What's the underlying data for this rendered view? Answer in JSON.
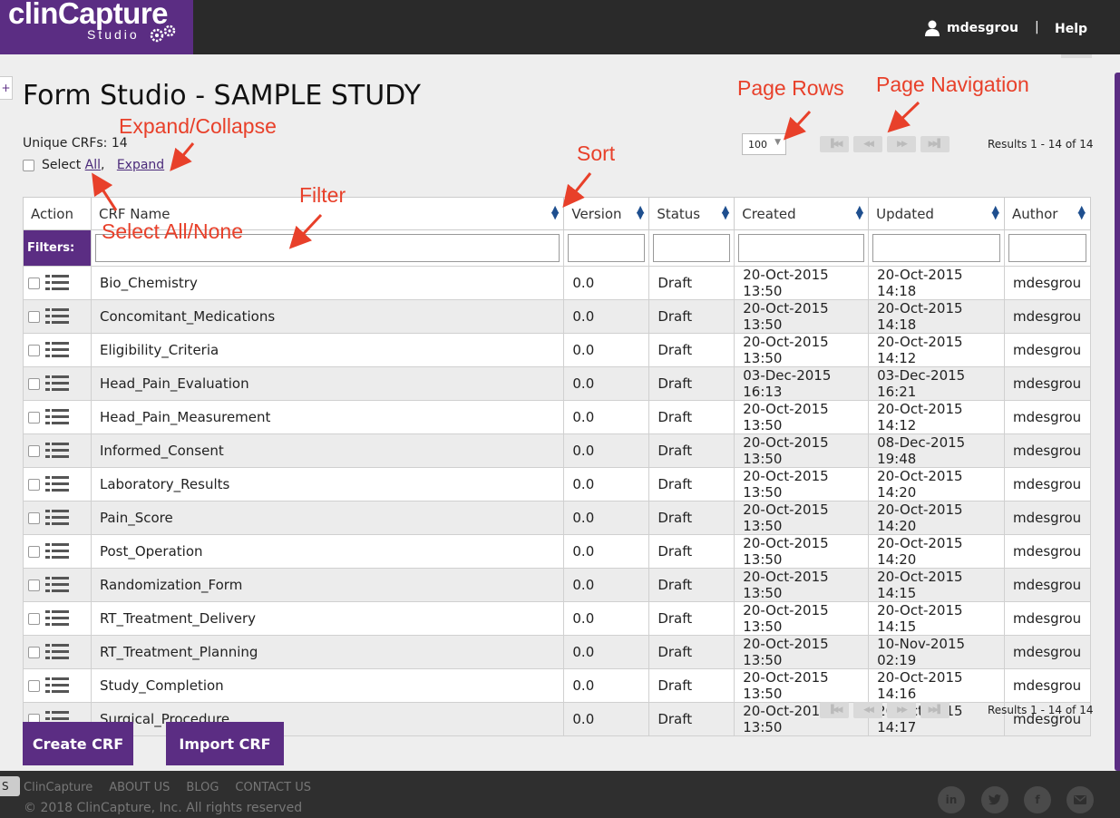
{
  "header": {
    "logo_main": "clinCapture",
    "logo_sub": "Studio",
    "username": "mdesgrou",
    "separator": "|",
    "help": "Help"
  },
  "page": {
    "title": "Form Studio - SAMPLE STUDY",
    "unique_crfs": "Unique CRFs: 14",
    "select_label": "Select",
    "select_all": "All",
    "comma": ",",
    "expand": "Expand",
    "rows_per_page": "100",
    "results_top": "Results 1 - 14 of 14",
    "results_bottom": "Results 1 - 14 of 14"
  },
  "annotations": {
    "page_rows": "Page Rows",
    "page_navigation": "Page Navigation",
    "expand_collapse": "Expand/Collapse",
    "sort": "Sort",
    "filter": "Filter",
    "select_all_none": "Select All/None"
  },
  "table": {
    "headers": [
      "Action",
      "CRF Name",
      "Version",
      "Status",
      "Created",
      "Updated",
      "Author"
    ],
    "filters_label": "Filters:",
    "rows": [
      [
        "Bio_Chemistry",
        "0.0",
        "Draft",
        "20-Oct-2015 13:50",
        "20-Oct-2015 14:18",
        "mdesgrou"
      ],
      [
        "Concomitant_Medications",
        "0.0",
        "Draft",
        "20-Oct-2015 13:50",
        "20-Oct-2015 14:18",
        "mdesgrou"
      ],
      [
        "Eligibility_Criteria",
        "0.0",
        "Draft",
        "20-Oct-2015 13:50",
        "20-Oct-2015 14:12",
        "mdesgrou"
      ],
      [
        "Head_Pain_Evaluation",
        "0.0",
        "Draft",
        "03-Dec-2015 16:13",
        "03-Dec-2015 16:21",
        "mdesgrou"
      ],
      [
        "Head_Pain_Measurement",
        "0.0",
        "Draft",
        "20-Oct-2015 13:50",
        "20-Oct-2015 14:12",
        "mdesgrou"
      ],
      [
        "Informed_Consent",
        "0.0",
        "Draft",
        "20-Oct-2015 13:50",
        "08-Dec-2015 19:48",
        "mdesgrou"
      ],
      [
        "Laboratory_Results",
        "0.0",
        "Draft",
        "20-Oct-2015 13:50",
        "20-Oct-2015 14:20",
        "mdesgrou"
      ],
      [
        "Pain_Score",
        "0.0",
        "Draft",
        "20-Oct-2015 13:50",
        "20-Oct-2015 14:20",
        "mdesgrou"
      ],
      [
        "Post_Operation",
        "0.0",
        "Draft",
        "20-Oct-2015 13:50",
        "20-Oct-2015 14:20",
        "mdesgrou"
      ],
      [
        "Randomization_Form",
        "0.0",
        "Draft",
        "20-Oct-2015 13:50",
        "20-Oct-2015 14:15",
        "mdesgrou"
      ],
      [
        "RT_Treatment_Delivery",
        "0.0",
        "Draft",
        "20-Oct-2015 13:50",
        "20-Oct-2015 14:15",
        "mdesgrou"
      ],
      [
        "RT_Treatment_Planning",
        "0.0",
        "Draft",
        "20-Oct-2015 13:50",
        "10-Nov-2015 02:19",
        "mdesgrou"
      ],
      [
        "Study_Completion",
        "0.0",
        "Draft",
        "20-Oct-2015 13:50",
        "20-Oct-2015 14:16",
        "mdesgrou"
      ],
      [
        "Surgical_Procedure",
        "0.0",
        "Draft",
        "20-Oct-2015 13:50",
        "20-Oct-2015 14:17",
        "mdesgrou"
      ]
    ]
  },
  "buttons": {
    "create": "Create CRF",
    "import": "Import CRF"
  },
  "footer": {
    "side_tab": "S",
    "brand": "ClinCapture",
    "about": "ABOUT US",
    "blog": "BLOG",
    "contact": "CONTACT US",
    "copyright": "© 2018 ClinCapture, Inc. All rights reserved",
    "social_icons": [
      "linkedin-icon",
      "twitter-icon",
      "facebook-icon",
      "email-icon"
    ]
  },
  "colors": {
    "brand_purple": "#5b2d83",
    "annotation_red": "#e8402a",
    "topbar": "#2a2a2a"
  }
}
